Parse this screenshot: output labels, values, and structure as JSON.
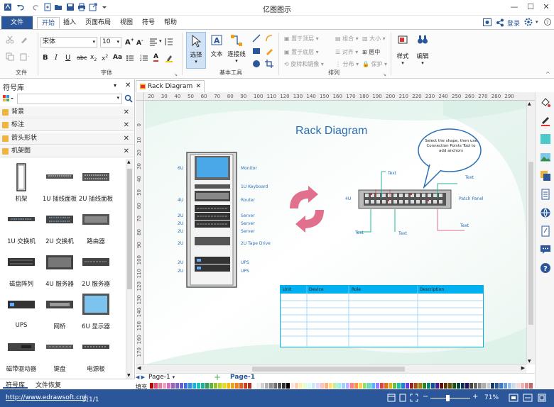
{
  "app": {
    "title": "亿图图示"
  },
  "tabs": [
    "文件",
    "开始",
    "插入",
    "页面布局",
    "视图",
    "符号",
    "帮助"
  ],
  "top_right": {
    "login": "登录"
  },
  "ribbon": {
    "font_name": "宋体",
    "font_size": "10",
    "groups": [
      "文件",
      "字体",
      "基本工具",
      "排列"
    ],
    "tools": [
      "选择",
      "文本",
      "连接线"
    ],
    "arrange": [
      "置于顶层",
      "组合",
      "大小",
      "置于底层",
      "对齐",
      "居中",
      "旋转和镜像",
      "分布",
      "保护"
    ],
    "style_label": "样式",
    "edit_label": "编辑"
  },
  "left_panel": {
    "title": "符号库",
    "libraries": [
      "背景",
      "标注",
      "箭头形状",
      "机架图"
    ],
    "shapes": [
      "机架",
      "1U 插线面板",
      "2U 插线面板",
      "1U 交换机",
      "2U 交换机",
      "路由器",
      "磁盘阵列",
      "4U 服务器",
      "2U 服务器",
      "UPS",
      "网桥",
      "6U 显示器",
      "磁带驱动器",
      "键盘",
      "电源板"
    ],
    "bottom_tabs": [
      "符号库",
      "文件恢复"
    ]
  },
  "document": {
    "tab_title": "Rack Diagram",
    "diagram_title": "Rack Diagram",
    "rack_left_labels": [
      "6U",
      "4U",
      "2U",
      "2U",
      "2U",
      "2U",
      "2U",
      "2U"
    ],
    "rack_right_labels": [
      "Monitor",
      "1U Keyboard",
      "Router",
      "Server",
      "Server",
      "Server",
      "2U Tape Drive",
      "UPS",
      "UPS"
    ],
    "callout": "Select the shape, then use Connection Points Tool to add anchors",
    "patch_label": "4U",
    "patch_panel": "Patch Panel",
    "text_labels": [
      "Text",
      "Text",
      "Text",
      "Text",
      "Text"
    ],
    "table_headers": [
      "Unit",
      "Device",
      "Role",
      "Description"
    ],
    "ruler_top": [
      "0",
      "10",
      "20",
      "30",
      "40",
      "50",
      "60",
      "70",
      "80",
      "90",
      "100",
      "110",
      "120",
      "130",
      "140",
      "150",
      "160",
      "170",
      "180",
      "190",
      "200",
      "210",
      "220",
      "230",
      "240",
      "250",
      "260",
      "270",
      "280",
      "290"
    ],
    "ruler_left": [
      "0",
      "10",
      "20",
      "30",
      "40",
      "50",
      "60",
      "70",
      "80",
      "90",
      "100",
      "110",
      "120",
      "130",
      "140",
      "150",
      "160",
      "170",
      "180",
      "190"
    ]
  },
  "page_bar": {
    "page_tab": "Page-1",
    "page_active": "Page-1",
    "fill_label": "填充"
  },
  "status": {
    "url": "http://www.edrawsoft.cn/",
    "page": "页1/1",
    "zoom": "71%"
  }
}
